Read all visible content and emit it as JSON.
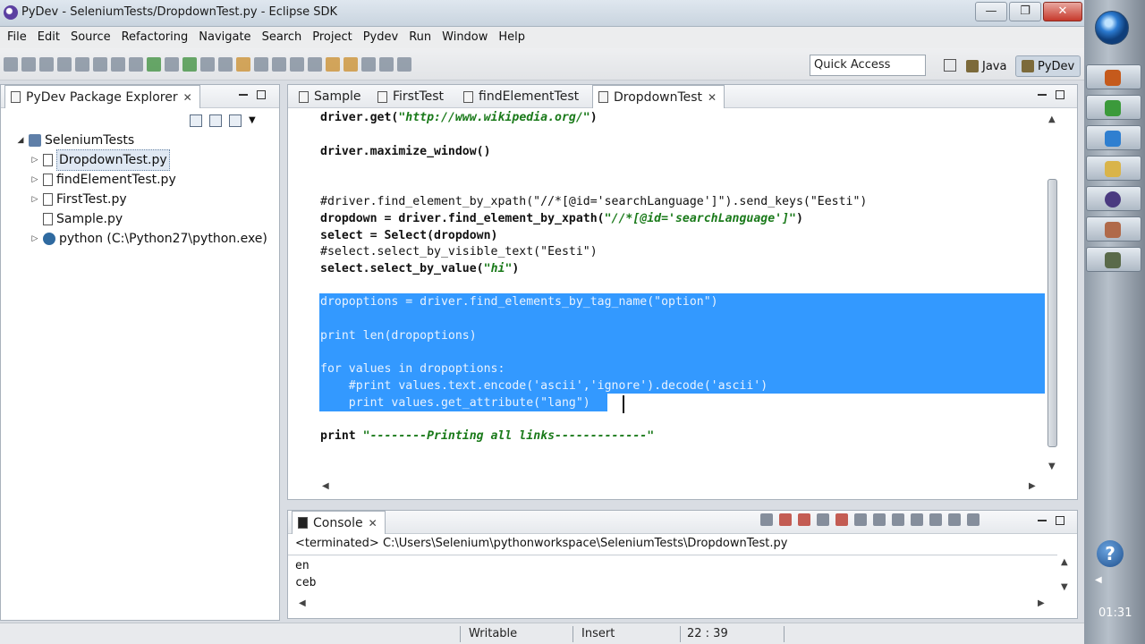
{
  "window": {
    "title": "PyDev - SeleniumTests/DropdownTest.py - Eclipse SDK",
    "buttons": {
      "minimize": "—",
      "maximize": "❐",
      "close": "✕"
    }
  },
  "menu": [
    "File",
    "Edit",
    "Source",
    "Refactoring",
    "Navigate",
    "Search",
    "Project",
    "Pydev",
    "Run",
    "Window",
    "Help"
  ],
  "toolbar": {
    "quick_access": "Quick Access",
    "perspectives": [
      "Java",
      "PyDev"
    ]
  },
  "package_explorer": {
    "title": "PyDev Package Explorer",
    "tree": [
      {
        "label": "SeleniumTests",
        "twisty": "◢",
        "icon": "project-icon"
      },
      {
        "label": "DropdownTest.py",
        "twisty": "▷",
        "icon": "file-icon",
        "selected": true
      },
      {
        "label": "findElementTest.py",
        "twisty": "▷",
        "icon": "file-icon"
      },
      {
        "label": "FirstTest.py",
        "twisty": "▷",
        "icon": "file-icon"
      },
      {
        "label": "Sample.py",
        "twisty": "",
        "icon": "file-icon"
      },
      {
        "label": "python  (C:\\Python27\\python.exe)",
        "twisty": "▷",
        "icon": "python-icon"
      }
    ]
  },
  "editor": {
    "tabs": [
      "Sample",
      "FirstTest",
      "findElementTest",
      "DropdownTest"
    ],
    "active_tab": "DropdownTest",
    "lines": {
      "l1a": "driver.get(",
      "l1s": "\"http://www.wikipedia.org/\"",
      "l1b": ")",
      "l2": "driver.maximize_window()",
      "l3": "#driver.find_element_by_xpath(\"//*[@id='searchLanguage']\").send_keys(\"Eesti\")",
      "l4a": "dropdown = driver.find_element_by_xpath(",
      "l4s": "\"//*[@id='searchLanguage']\"",
      "l4b": ")",
      "l5": "select = Select(dropdown)",
      "l6": "#select.select_by_visible_text(\"Eesti\")",
      "l7a": "select.select_by_value(",
      "l7s": "\"hi\"",
      "l7b": ")",
      "l8": "dropoptions = driver.find_elements_by_tag_name(\"option\")",
      "l9": "print len(dropoptions)",
      "l10": "for values in dropoptions:",
      "l11": "    #print values.text.encode('ascii','ignore').decode('ascii')",
      "l12": "    print values.get_attribute(\"lang\")",
      "l13a": "print ",
      "l13s": "\"--------Printing all links-------------\""
    }
  },
  "console": {
    "title": "Console",
    "path": "<terminated> C:\\Users\\Selenium\\pythonworkspace\\SeleniumTests\\DropdownTest.py",
    "output": [
      "en",
      "ceb"
    ]
  },
  "status": {
    "writable": "Writable",
    "insert": "Insert",
    "position": "22 : 39"
  },
  "taskbar": {
    "clock": "01:31",
    "help": "?"
  }
}
